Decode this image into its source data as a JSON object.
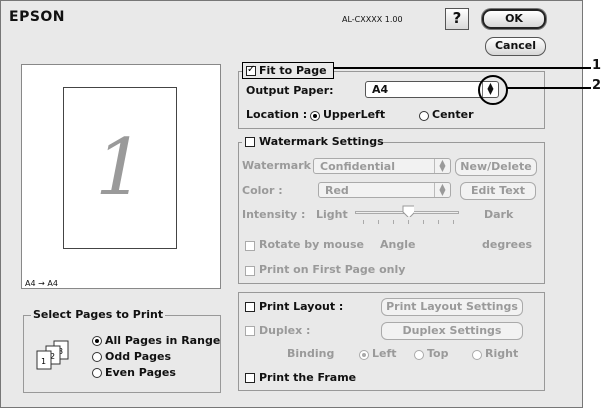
{
  "header": {
    "logo": "EPSON",
    "model": "AL-CXXXX 1.00",
    "help_glyph": "?",
    "ok_label": "OK",
    "cancel_label": "Cancel"
  },
  "preview": {
    "page_number": "1",
    "paper_caption": "A4 → A4"
  },
  "select_pages": {
    "title": "Select Pages to Print",
    "options": [
      {
        "label": "All Pages in Range",
        "selected": true
      },
      {
        "label": "Odd Pages",
        "selected": false
      },
      {
        "label": "Even Pages",
        "selected": false
      }
    ],
    "icon": "stacked-pages-icon"
  },
  "fit_to_page": {
    "label": "Fit to Page",
    "checked": true,
    "output_paper_label": "Output Paper:",
    "output_paper_value": "A4",
    "location_label": "Location :",
    "location_options": [
      "UpperLeft",
      "Center"
    ],
    "location_selected": "UpperLeft"
  },
  "watermark": {
    "label": "Watermark Settings",
    "checked": false,
    "watermark_label": "Watermark :",
    "watermark_value": "Confidential",
    "new_delete_label": "New/Delete",
    "color_label": "Color :",
    "color_value": "Red",
    "edit_text_label": "Edit Text",
    "intensity_label": "Intensity :",
    "intensity_light": "Light",
    "intensity_dark": "Dark",
    "intensity_level": 0.5,
    "rotate_label": "Rotate by mouse",
    "angle_label": "Angle",
    "degrees_label": "degrees",
    "first_page_label": "Print on First Page only"
  },
  "layout": {
    "print_layout_label": "Print Layout :",
    "print_layout_settings_label": "Print Layout Settings",
    "duplex_label": "Duplex :",
    "duplex_settings_label": "Duplex Settings",
    "binding_label": "Binding",
    "binding_options": [
      "Left",
      "Top",
      "Right"
    ],
    "binding_selected": "Left",
    "print_frame_label": "Print the Frame"
  },
  "callouts": [
    "1",
    "2"
  ]
}
